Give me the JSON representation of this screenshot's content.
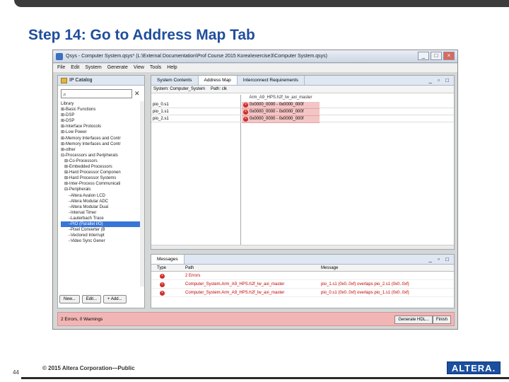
{
  "slide": {
    "title": "Step 14: Go to Address Map Tab",
    "page_number": "44",
    "copyright": "© 2015 Altera Corporation—Public",
    "logo_text": "ALTERA."
  },
  "window": {
    "title": "Qsys - Computer System.qsys* (L:\\External Documentation\\Prof Course 2015 Korea\\exercise3\\Computer System.qsys)",
    "controls": [
      "_",
      "□",
      "×"
    ]
  },
  "menu": [
    "File",
    "Edit",
    "System",
    "Generate",
    "View",
    "Tools",
    "Help"
  ],
  "ip_catalog": {
    "tab_label": "IP Catalog",
    "tree": [
      "Library",
      "⊞-Basic Functions",
      "⊞-DSP",
      "⊞-DSP",
      "⊞-Interface Protocols",
      "⊞-Low Power",
      "⊞-Memory Interfaces and Contr",
      "⊞-Memory Interfaces and Contr",
      "⊞-other",
      "⊟-Processors and Peripherals",
      "   ⊞-Co-Processors",
      "   ⊞-Embedded Processors",
      "   ⊞-Hard Processor Componen",
      "   ⊞-Hard Processor Systems",
      "   ⊞-Inter-Process Communicati",
      "   ⊟-Peripherals",
      "      ·-Altera Avalon LCD",
      "      ·-Altera Modular ADC",
      "      ·-Altera Modular Dual",
      "      ·-Interval Timer",
      "      ·-Lauterbach Trace",
      "      ·-PIO (Parallel I/O)",
      "      ·-Pixel Converter (B",
      "      ·-Vectored Interrupt",
      "      ·-Video Sync Gener"
    ],
    "selected_index": 21,
    "buttons": [
      "New...",
      "Edit...",
      "+ Add..."
    ]
  },
  "main_tabs": [
    "System Contents",
    "Address Map",
    "Interconnect Requirements"
  ],
  "active_tab": 1,
  "system_row": {
    "system": "System: Computer_System",
    "path": "Path: clk"
  },
  "address_map": {
    "column_header": "Arm_A9_HPS.h2f_lw_axi_master",
    "rows": [
      {
        "slave": "pio_0.s1",
        "range": "0x0000_0000 - 0x0000_000f"
      },
      {
        "slave": "pio_1.s1",
        "range": "0x0000_0000 - 0x0000_000f"
      },
      {
        "slave": "pio_2.s1",
        "range": "0x0000_0000 - 0x0000_000f"
      }
    ]
  },
  "messages": {
    "tab_label": "Messages",
    "headers": [
      "Type",
      "Path",
      "Message"
    ],
    "rows": [
      {
        "path": "2 Errors",
        "message": ""
      },
      {
        "path": "Computer_System.Arm_A9_HPS.h2f_lw_axi_master",
        "message": "pio_1.s1 (0x0..0xf) overlaps pio_2.s1 (0x0..0xf)"
      },
      {
        "path": "Computer_System.Arm_A9_HPS.h2f_lw_axi_master",
        "message": "pio_0.s1 (0x0..0xf) overlaps pio_1.s1 (0x0..0xf)"
      }
    ]
  },
  "status": {
    "text": "2 Errors, 0 Warnings",
    "generate_label": "Generate HDL...",
    "finish_label": "Finish"
  },
  "colors": {
    "title_blue": "#1f4e9c",
    "error_red": "#d12c2c",
    "error_bg": "#f4c5c5",
    "status_bg": "#f2b5b5"
  }
}
